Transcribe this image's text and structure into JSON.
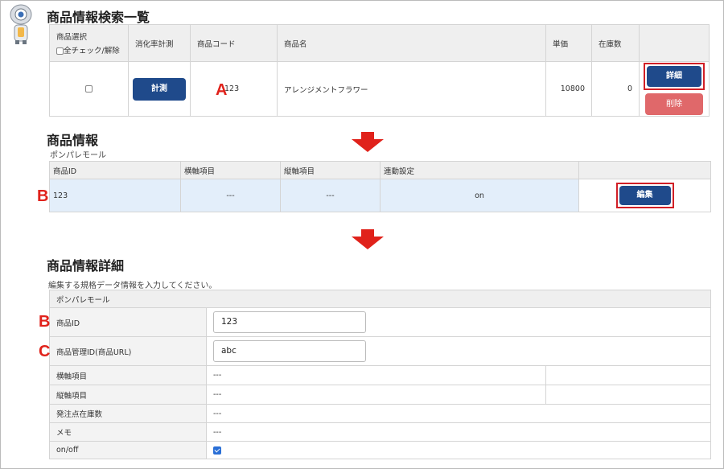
{
  "search": {
    "title": "商品情報検索一覧",
    "headers": {
      "select": "商品選択",
      "check_all": "全チェック/解除",
      "consumption": "消化率計測",
      "code": "商品コード",
      "name": "商品名",
      "price": "単価",
      "stock": "在庫数"
    },
    "row": {
      "measure_label": "計測",
      "code": "123",
      "name": "アレンジメントフラワー",
      "price": "10800",
      "stock": "0",
      "detail_label": "詳細",
      "delete_label": "削除"
    }
  },
  "info": {
    "title": "商品情報",
    "shop": "ポンパレモール",
    "headers": {
      "id": "商品ID",
      "h_axis": "横軸項目",
      "v_axis": "縦軸項目",
      "link": "連動設定"
    },
    "row": {
      "id": "123",
      "h_axis": "---",
      "v_axis": "---",
      "link": "on",
      "edit_label": "編集"
    }
  },
  "detail": {
    "title": "商品情報詳細",
    "desc": "編集する規格データ情報を入力してください。",
    "shop": "ポンパレモール",
    "rows": {
      "id_label": "商品ID",
      "id_value": "123",
      "mgmt_label": "商品管理ID(商品URL)",
      "mgmt_value": "abc",
      "h_label": "横軸項目",
      "h_value": "---",
      "v_label": "縦軸項目",
      "v_value": "---",
      "order_label": "発注点在庫数",
      "order_value": "---",
      "memo_label": "メモ",
      "memo_value": "---",
      "onoff_label": "on/off"
    }
  },
  "markers": {
    "a": "A",
    "b": "B",
    "c": "C"
  },
  "colors": {
    "primary": "#1f4a8b",
    "danger": "#e0686a",
    "highlight": "#d11f26",
    "row_highlight": "#e3eefa"
  }
}
